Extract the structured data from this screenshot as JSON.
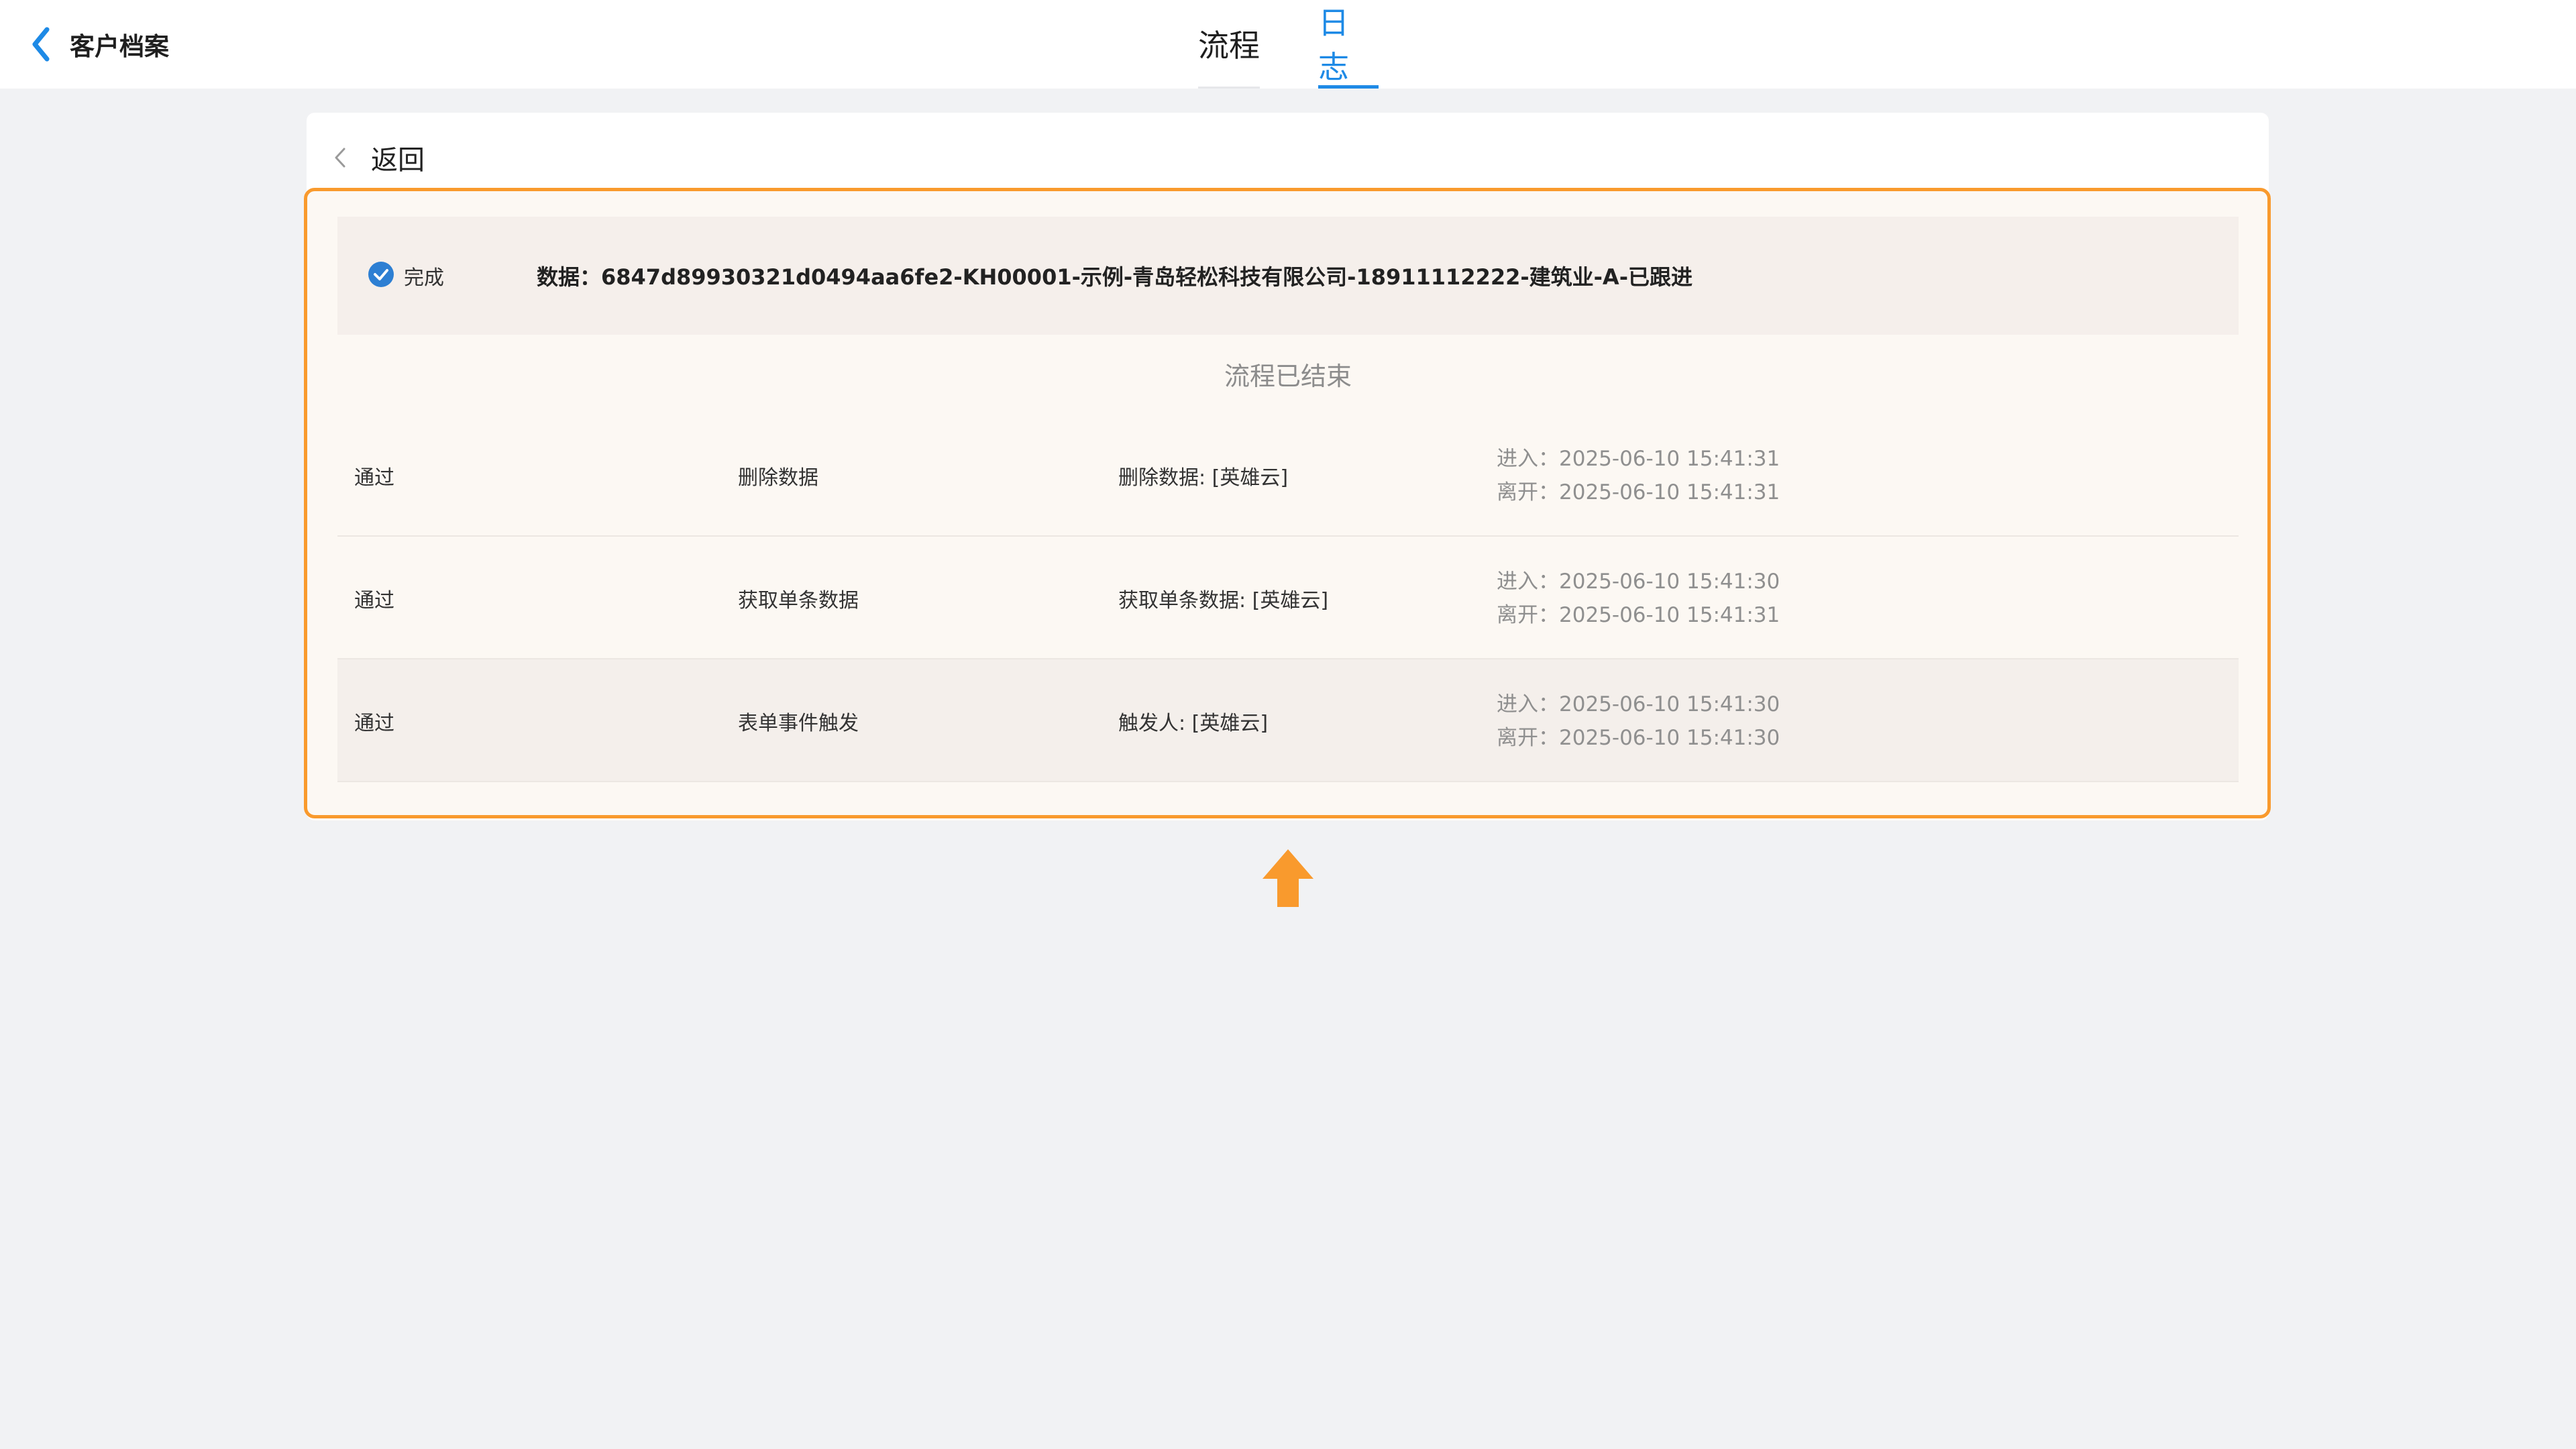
{
  "header": {
    "back_title": "客户档案",
    "tabs": [
      {
        "label": "流程",
        "active": false
      },
      {
        "label": "日志",
        "active": true
      }
    ]
  },
  "card": {
    "back_label": "返回",
    "status_label": "完成",
    "data_text": "数据：6847d89930321d0494aa6fe2-KH00001-示例-青岛轻松科技有限公司-18911112222-建筑业-A-已跟进",
    "ended_text": "流程已结束",
    "rows": [
      {
        "result": "通过",
        "node": "删除数据",
        "detail": "删除数据: [英雄云]",
        "enter": "进入：2025-06-10 15:41:31",
        "leave": "离开：2025-06-10 15:41:31"
      },
      {
        "result": "通过",
        "node": "获取单条数据",
        "detail": "获取单条数据: [英雄云]",
        "enter": "进入：2025-06-10 15:41:30",
        "leave": "离开：2025-06-10 15:41:31"
      },
      {
        "result": "通过",
        "node": "表单事件触发",
        "detail": "触发人: [英雄云]",
        "enter": "进入：2025-06-10 15:41:30",
        "leave": "离开：2025-06-10 15:41:30"
      }
    ]
  },
  "colors": {
    "accent": "#1e8ae6",
    "highlight": "#f99a2d",
    "check": "#2d7fd3"
  },
  "icons": {
    "back": "chevron-left-icon",
    "card_back": "chevron-left-icon",
    "status": "check-circle-icon",
    "annotation": "arrow-up-icon"
  }
}
